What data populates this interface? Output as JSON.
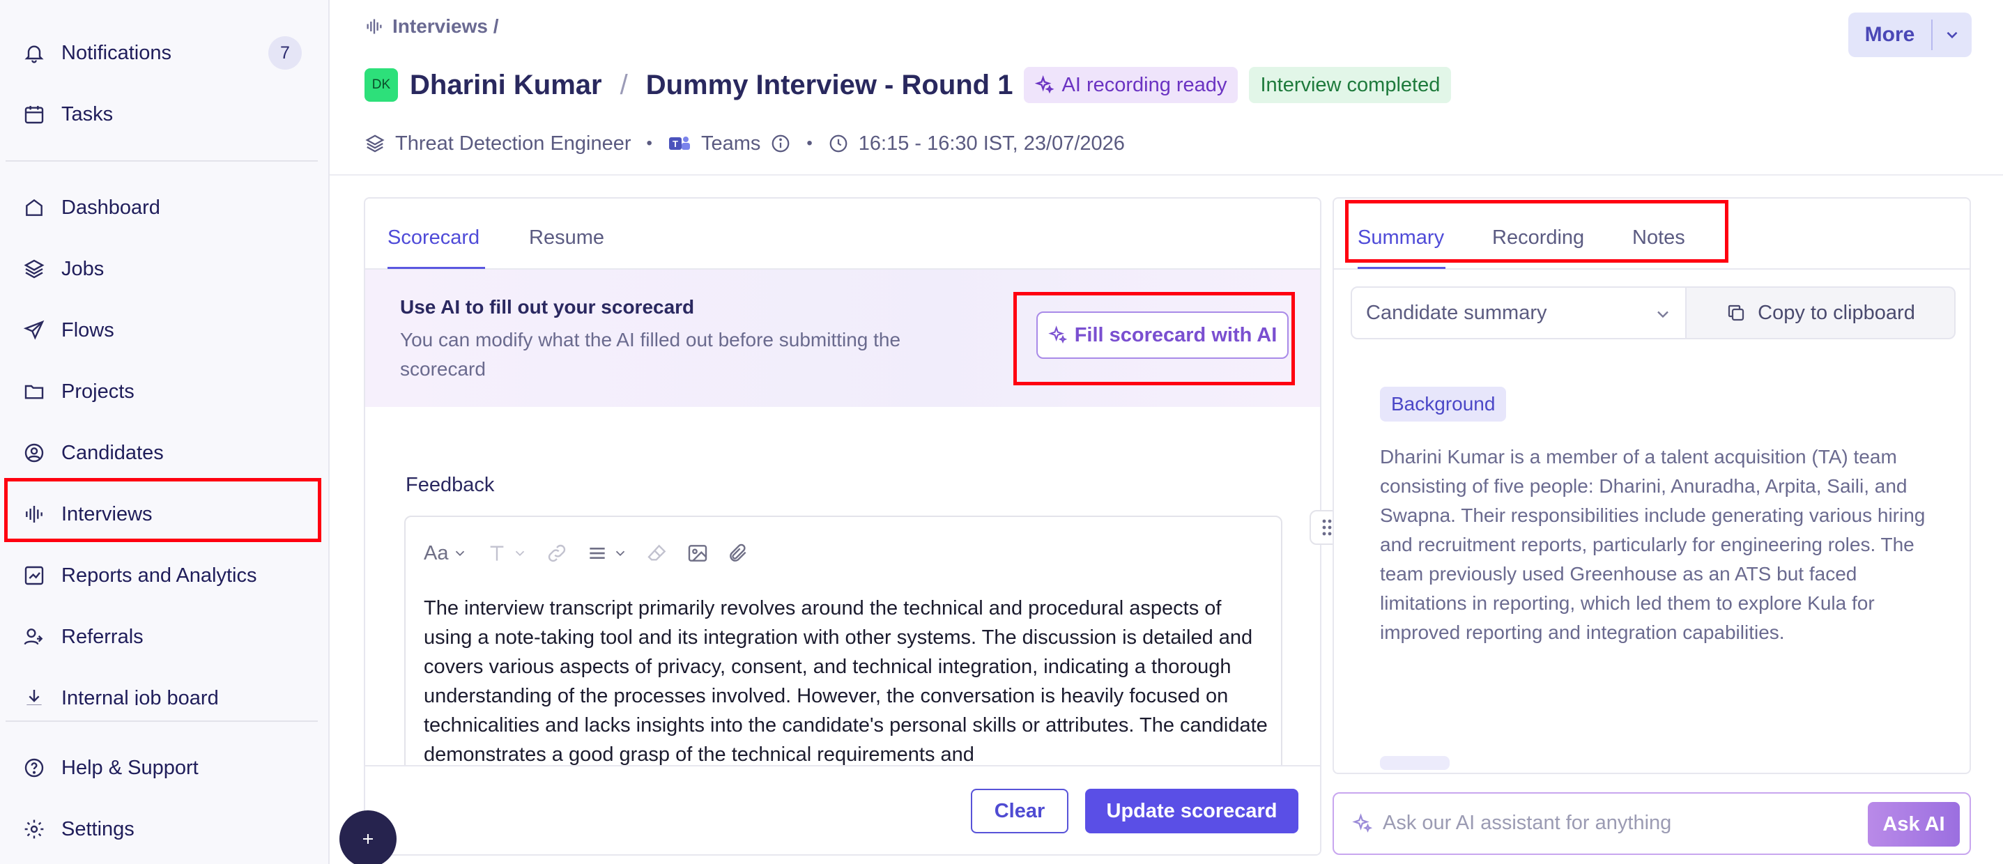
{
  "sidebar": {
    "notifications": {
      "label": "Notifications",
      "count": "7"
    },
    "items": [
      {
        "label": "Tasks",
        "icon": "calendar-icon"
      },
      {
        "label": "Dashboard",
        "icon": "home-icon"
      },
      {
        "label": "Jobs",
        "icon": "layers-icon"
      },
      {
        "label": "Flows",
        "icon": "send-icon"
      },
      {
        "label": "Projects",
        "icon": "folder-icon"
      },
      {
        "label": "Candidates",
        "icon": "user-circle-icon"
      },
      {
        "label": "Interviews",
        "icon": "waveform-icon"
      },
      {
        "label": "Reports and Analytics",
        "icon": "chart-icon"
      },
      {
        "label": "Referrals",
        "icon": "referral-icon"
      },
      {
        "label": "Internal job board",
        "icon": "download-icon"
      },
      {
        "label": "Help & Support",
        "icon": "help-icon"
      },
      {
        "label": "Settings",
        "icon": "gear-icon"
      }
    ]
  },
  "header": {
    "breadcrumb": "Interviews /",
    "more_label": "More",
    "avatar_initials": "DK",
    "candidate_name": "Dharini Kumar",
    "separator": "/",
    "interview_title": "Dummy Interview - Round 1",
    "ai_badge": "AI recording ready",
    "status_badge": "Interview completed",
    "role": "Threat Detection Engineer",
    "platform": "Teams",
    "time": "16:15 - 16:30 IST, 23/07/2026"
  },
  "left_panel": {
    "tabs": [
      "Scorecard",
      "Resume"
    ],
    "ai_banner": {
      "title": "Use AI to fill out your scorecard",
      "description": "You can modify what the AI filled out before submitting the scorecard",
      "button": "Fill scorecard with AI"
    },
    "feedback_label": "Feedback",
    "toolbar_font": "Aa",
    "feedback_text": "The interview transcript primarily revolves around the technical and procedural aspects of using a note-taking tool and its integration with other systems. The discussion is detailed and covers various aspects of privacy, consent, and technical integration, indicating a thorough understanding of the processes involved. However, the conversation is heavily focused on technicalities and lacks insights into the candidate's personal skills or attributes. The candidate demonstrates a good grasp of the technical requirements and",
    "clear_button": "Clear",
    "update_button": "Update scorecard"
  },
  "right_panel": {
    "tabs": [
      "Summary",
      "Recording",
      "Notes"
    ],
    "select_value": "Candidate summary",
    "copy_button": "Copy to clipboard",
    "section_tag": "Background",
    "summary_text": "Dharini Kumar is a member of a talent acquisition (TA) team consisting of five people: Dharini, Anuradha, Arpita, Saili, and Swapna. Their responsibilities include generating various hiring and recruitment reports, particularly for engineering roles. The team previously used Greenhouse as an ATS but faced limitations in reporting, which led them to explore Kula for improved reporting and integration capabilities."
  },
  "ask_ai": {
    "placeholder": "Ask our AI assistant for anything",
    "button": "Ask AI"
  },
  "colors": {
    "accent": "#5a4fe6",
    "highlight_box": "#ff0010",
    "ai_purple": "#6b33c2",
    "success_green": "#1e7a3c"
  }
}
